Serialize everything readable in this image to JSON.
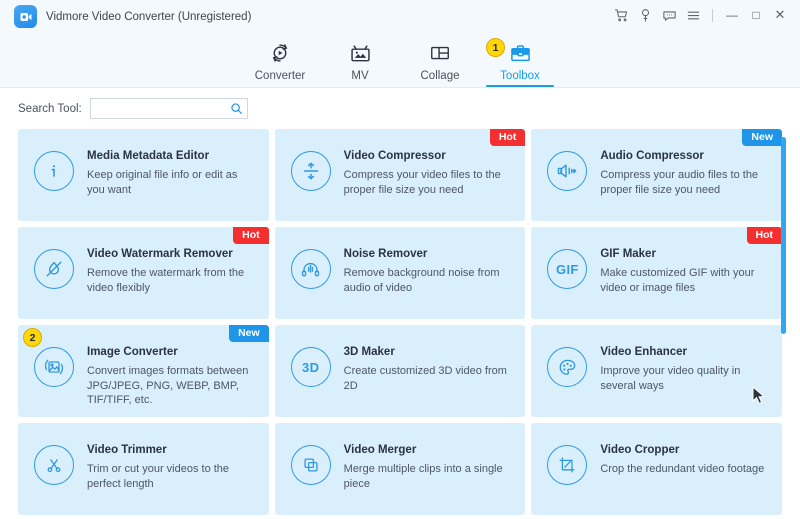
{
  "window": {
    "title": "Vidmore Video Converter (Unregistered)",
    "logo_icon": "app-logo-icon",
    "controls": [
      {
        "name": "cart-icon",
        "glyph": "cart"
      },
      {
        "name": "key-icon",
        "glyph": "key"
      },
      {
        "name": "feedback-icon",
        "glyph": "chat"
      },
      {
        "name": "menu-icon",
        "glyph": "hamburger"
      }
    ],
    "minimize_label": "—",
    "maximize_label": "□",
    "close_label": "✕"
  },
  "nav": {
    "tabs": [
      {
        "label": "Converter",
        "icon": "converter-icon",
        "active": false,
        "step": null
      },
      {
        "label": "MV",
        "icon": "mv-icon",
        "active": false,
        "step": null
      },
      {
        "label": "Collage",
        "icon": "collage-icon",
        "active": false,
        "step": null
      },
      {
        "label": "Toolbox",
        "icon": "toolbox-icon",
        "active": true,
        "step": "1"
      }
    ]
  },
  "search": {
    "label": "Search Tool:",
    "value": "",
    "placeholder": "",
    "icon": "search-icon"
  },
  "tools": [
    {
      "title": "Media Metadata Editor",
      "desc": "Keep original file info or edit as you want",
      "icon": "info-circle-icon",
      "flag": null,
      "step": null
    },
    {
      "title": "Video Compressor",
      "desc": "Compress your video files to the proper file size you need",
      "icon": "compress-arrows-icon",
      "flag": "Hot",
      "flag_kind": "hot",
      "step": null
    },
    {
      "title": "Audio Compressor",
      "desc": "Compress your audio files to the proper file size you need",
      "icon": "speaker-icon",
      "flag": "New",
      "flag_kind": "new",
      "step": null
    },
    {
      "title": "Video Watermark Remover",
      "desc": "Remove the watermark from the video flexibly",
      "icon": "watermark-droplet-icon",
      "flag": "Hot",
      "flag_kind": "hot",
      "step": null
    },
    {
      "title": "Noise Remover",
      "desc": "Remove background noise from audio of video",
      "icon": "headphones-icon",
      "flag": null,
      "step": null
    },
    {
      "title": "GIF Maker",
      "desc": "Make customized GIF with your video or image files",
      "icon": "gif-text-icon",
      "flag": "Hot",
      "flag_kind": "hot",
      "step": null
    },
    {
      "title": "Image Converter",
      "desc": "Convert images formats between JPG/JPEG, PNG, WEBP, BMP, TIF/TIFF, etc.",
      "icon": "image-convert-icon",
      "flag": "New",
      "flag_kind": "new",
      "step": "2"
    },
    {
      "title": "3D Maker",
      "desc": "Create customized 3D video from 2D",
      "icon": "three-d-text-icon",
      "flag": null,
      "step": null
    },
    {
      "title": "Video Enhancer",
      "desc": "Improve your video quality in several ways",
      "icon": "palette-icon",
      "flag": null,
      "step": null
    },
    {
      "title": "Video Trimmer",
      "desc": "Trim or cut your videos to the perfect length",
      "icon": "scissors-icon",
      "flag": null,
      "step": null
    },
    {
      "title": "Video Merger",
      "desc": "Merge multiple clips into a single piece",
      "icon": "merge-squares-icon",
      "flag": null,
      "step": null
    },
    {
      "title": "Video Cropper",
      "desc": "Crop the redundant video footage",
      "icon": "crop-icon",
      "flag": null,
      "step": null
    }
  ],
  "scrollbar": {
    "name": "vertical-scrollbar"
  },
  "colors": {
    "accent": "#1a9ae8",
    "card_bg": "#daeffc",
    "hot": "#f42f2f",
    "new": "#1e95e8",
    "badge": "#ffd60a",
    "titlebar": "#f4f9fd"
  }
}
